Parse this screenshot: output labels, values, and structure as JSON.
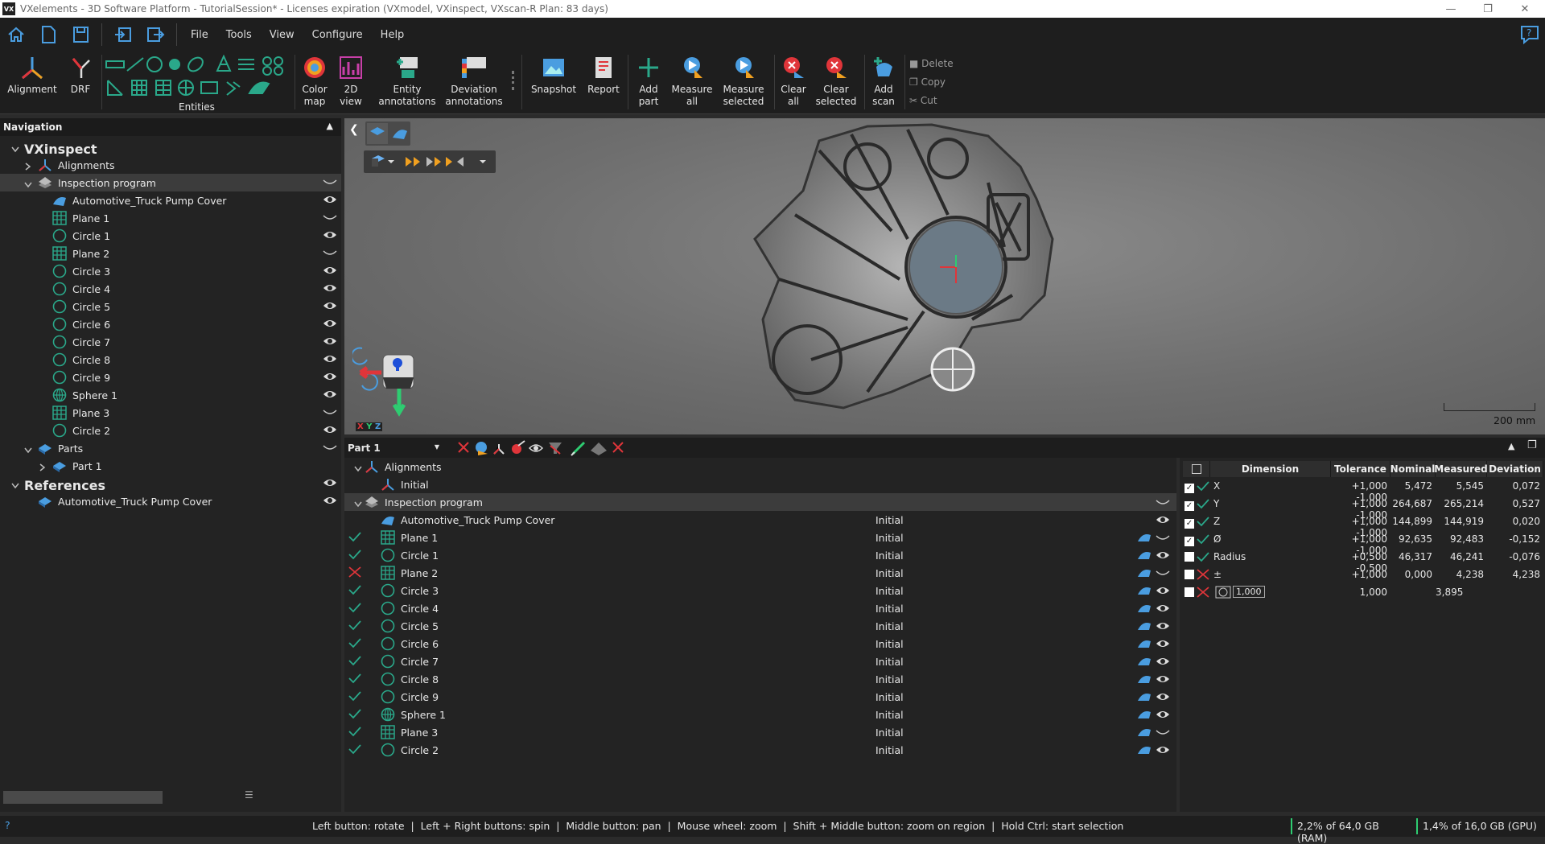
{
  "window": {
    "title": "VXelements - 3D Software Platform - TutorialSession* - Licenses expiration (VXmodel, VXinspect, VXscan-R Plan: 83 days)",
    "logo": "VX"
  },
  "menu": [
    "File",
    "Tools",
    "View",
    "Configure",
    "Help"
  ],
  "ribbon": {
    "alignment": "Alignment",
    "drf": "DRF",
    "entities": "Entities",
    "color_map": [
      "Color",
      "map"
    ],
    "view2d": [
      "2D",
      "view"
    ],
    "entity_ann": [
      "Entity",
      "annotations"
    ],
    "dev_ann": [
      "Deviation",
      "annotations"
    ],
    "snapshot": "Snapshot",
    "report": "Report",
    "add_part": [
      "Add",
      "part"
    ],
    "measure_all": [
      "Measure",
      "all"
    ],
    "measure_sel": [
      "Measure",
      "selected"
    ],
    "clear_all": [
      "Clear",
      "all"
    ],
    "clear_sel": [
      "Clear",
      "selected"
    ],
    "add_scan": [
      "Add",
      "scan"
    ],
    "delete": "Delete",
    "copy": "Copy",
    "cut": "Cut"
  },
  "nav": {
    "header": "Navigation",
    "root": "VXinspect",
    "alignments": "Alignments",
    "inspection": "Inspection program",
    "items": [
      {
        "label": "Automotive_Truck Pump Cover",
        "icon": "mesh",
        "eye": true
      },
      {
        "label": "Plane 1",
        "icon": "plane",
        "eye": false
      },
      {
        "label": "Circle 1",
        "icon": "circle",
        "eye": true
      },
      {
        "label": "Plane 2",
        "icon": "plane",
        "eye": false
      },
      {
        "label": "Circle 3",
        "icon": "circle",
        "eye": true
      },
      {
        "label": "Circle 4",
        "icon": "circle",
        "eye": true
      },
      {
        "label": "Circle 5",
        "icon": "circle",
        "eye": true
      },
      {
        "label": "Circle 6",
        "icon": "circle",
        "eye": true
      },
      {
        "label": "Circle 7",
        "icon": "circle",
        "eye": true
      },
      {
        "label": "Circle 8",
        "icon": "circle",
        "eye": true
      },
      {
        "label": "Circle 9",
        "icon": "circle",
        "eye": true
      },
      {
        "label": "Sphere 1",
        "icon": "sphere",
        "eye": true
      },
      {
        "label": "Plane 3",
        "icon": "plane",
        "eye": false
      },
      {
        "label": "Circle 2",
        "icon": "circle",
        "eye": true
      }
    ],
    "parts": "Parts",
    "part1": "Part 1",
    "references": "References",
    "ref_item": "Automotive_Truck Pump Cover"
  },
  "viewport": {
    "scale": "200 mm",
    "axes": [
      "X",
      "Y",
      "Z"
    ]
  },
  "bottom": {
    "part_select": "Part 1",
    "alignments": "Alignments",
    "initial": "Initial",
    "inspection": "Inspection program",
    "rows": [
      {
        "status": "none",
        "icon": "mesh",
        "label": "Automotive_Truck Pump Cover",
        "align": "Initial",
        "shape": false,
        "eye": true
      },
      {
        "status": "ok",
        "icon": "plane",
        "label": "Plane 1",
        "align": "Initial",
        "shape": true,
        "eye": false
      },
      {
        "status": "ok",
        "icon": "circle",
        "label": "Circle 1",
        "align": "Initial",
        "shape": true,
        "eye": true
      },
      {
        "status": "fail",
        "icon": "plane",
        "label": "Plane 2",
        "align": "Initial",
        "shape": true,
        "eye": false
      },
      {
        "status": "ok",
        "icon": "circle",
        "label": "Circle 3",
        "align": "Initial",
        "shape": true,
        "eye": true
      },
      {
        "status": "ok",
        "icon": "circle",
        "label": "Circle 4",
        "align": "Initial",
        "shape": true,
        "eye": true
      },
      {
        "status": "ok",
        "icon": "circle",
        "label": "Circle 5",
        "align": "Initial",
        "shape": true,
        "eye": true
      },
      {
        "status": "ok",
        "icon": "circle",
        "label": "Circle 6",
        "align": "Initial",
        "shape": true,
        "eye": true
      },
      {
        "status": "ok",
        "icon": "circle",
        "label": "Circle 7",
        "align": "Initial",
        "shape": true,
        "eye": true
      },
      {
        "status": "ok",
        "icon": "circle",
        "label": "Circle 8",
        "align": "Initial",
        "shape": true,
        "eye": true
      },
      {
        "status": "ok",
        "icon": "circle",
        "label": "Circle 9",
        "align": "Initial",
        "shape": true,
        "eye": true
      },
      {
        "status": "ok",
        "icon": "sphere",
        "label": "Sphere 1",
        "align": "Initial",
        "shape": true,
        "eye": true
      },
      {
        "status": "ok",
        "icon": "plane",
        "label": "Plane 3",
        "align": "Initial",
        "shape": true,
        "eye": false
      },
      {
        "status": "ok",
        "icon": "circle",
        "label": "Circle 2",
        "align": "Initial",
        "shape": true,
        "eye": true
      }
    ]
  },
  "dim_table": {
    "headers": [
      "Dimension",
      "Tolerance",
      "Nominal",
      "Measured",
      "Deviation"
    ],
    "rows": [
      {
        "checked": true,
        "status": "ok",
        "dim": "X",
        "tol": "+1,000 -1,000",
        "nom": "5,472",
        "meas": "5,545",
        "dev": "0,072"
      },
      {
        "checked": true,
        "status": "ok",
        "dim": "Y",
        "tol": "+1,000 -1,000",
        "nom": "264,687",
        "meas": "265,214",
        "dev": "0,527"
      },
      {
        "checked": true,
        "status": "ok",
        "dim": "Z",
        "tol": "+1,000 -1,000",
        "nom": "144,899",
        "meas": "144,919",
        "dev": "0,020"
      },
      {
        "checked": true,
        "status": "ok",
        "dim": "Ø",
        "tol": "+1,000 -1,000",
        "nom": "92,635",
        "meas": "92,483",
        "dev": "-0,152"
      },
      {
        "checked": false,
        "status": "ok",
        "dim": "Radius",
        "tol": "+0,500 -0,500",
        "nom": "46,317",
        "meas": "46,241",
        "dev": "-0,076"
      },
      {
        "checked": false,
        "status": "fail",
        "dim": "±",
        "tol": "+1,000",
        "nom": "0,000",
        "meas": "4,238",
        "dev": "4,238"
      },
      {
        "checked": false,
        "status": "fail",
        "dim": "1,000",
        "tol": "1,000",
        "nom": "",
        "meas": "3,895",
        "dev": ""
      }
    ]
  },
  "status": {
    "help": "?",
    "hints": "Left button: rotate  |  Left + Right buttons: spin  |  Middle button: pan  |  Mouse wheel: zoom  |  Shift + Middle button: zoom on region  |  Hold Ctrl: start selection",
    "ram": "2,2% of 64,0 GB (RAM)",
    "gpu": "1,4% of 16,0 GB (GPU)"
  },
  "colors": {
    "accent": "#2aa88a",
    "ok": "#2ecc71",
    "fail": "#e0353a",
    "blue": "#3a8fd8"
  }
}
